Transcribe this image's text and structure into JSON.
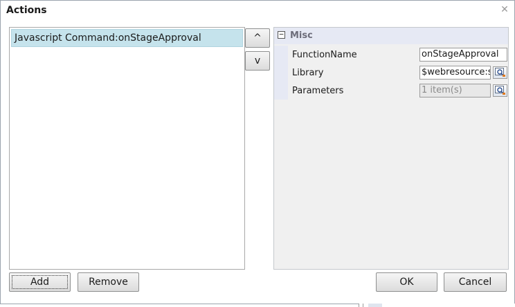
{
  "dialog": {
    "title": "Actions",
    "close_icon": "close-icon"
  },
  "actions_list": {
    "items": [
      {
        "label": "Javascript Command:onStageApproval",
        "selected": true
      }
    ]
  },
  "reorder": {
    "up_label": "^",
    "down_label": "v"
  },
  "properties": {
    "category": {
      "toggle": "⊟",
      "label": "Misc",
      "header_color": "#e6e9f4"
    },
    "rows": [
      {
        "name": "FunctionName",
        "value": "onStageApproval",
        "enabled": true,
        "has_lookup": false
      },
      {
        "name": "Library",
        "value": "$webresource:ss",
        "enabled": true,
        "has_lookup": true,
        "lookup_icon": "lookup-icon"
      },
      {
        "name": "Parameters",
        "value": "1 item(s)",
        "enabled": false,
        "has_lookup": true,
        "lookup_icon": "lookup-icon"
      }
    ]
  },
  "buttons": {
    "add": "Add",
    "remove": "Remove",
    "ok": "OK",
    "cancel": "Cancel"
  },
  "colors": {
    "selection": "#c5e3ec",
    "panel_bg": "#f0f0f0"
  }
}
